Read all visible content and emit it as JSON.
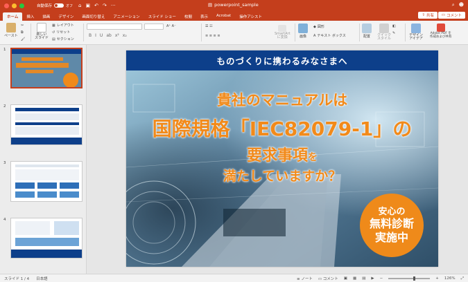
{
  "titlebar": {
    "autosave_label": "自動保存",
    "autosave_state": "オフ",
    "doc_title": "powerpoint_sample",
    "accent": "#c43e1c"
  },
  "tabs": [
    "ホーム",
    "挿入",
    "描画",
    "デザイン",
    "画面切り替え",
    "アニメーション",
    "スライド ショー",
    "校閲",
    "表示",
    "Acrobat",
    "操作アシスト"
  ],
  "active_tab": "ホーム",
  "share_label": "共有",
  "comment_label": "コメント",
  "ribbon": {
    "paste": "ペースト",
    "new_slide": "新しい\nスライド",
    "layout": "レイアウト",
    "reset": "リセット",
    "section": "セクション",
    "smartart": "SmartArt\nに変換",
    "image": "画像",
    "shape": "図形",
    "textbox": "テキスト ボックス",
    "arrange": "配置",
    "quick_style": "クイック\nスタイル",
    "design_ideas": "デザイン\nアイデア",
    "adobe": "Adobe PDF を\n作成および共有",
    "format_buttons": [
      "B",
      "I",
      "U",
      "ab",
      "x²",
      "x₂"
    ]
  },
  "thumbnails": [
    {
      "num": "1"
    },
    {
      "num": "2"
    },
    {
      "num": "3"
    },
    {
      "num": "4"
    }
  ],
  "slide": {
    "banner": "ものづくりに携わるみなさまへ",
    "line1": "貴社のマニュアルは",
    "line2": "国際規格「IEC82079-1」の",
    "line3_main": "要求事項",
    "line3_small": "を",
    "line4": "満たしていますか？",
    "badge_line1": "安心の",
    "badge_line2": "無料診断",
    "badge_line3": "実施中",
    "banner_color": "#0d3f8a",
    "title_color": "#f28a1a"
  },
  "status": {
    "slide_info": "スライド 1 / 4",
    "language": "日本語",
    "notes": "ノート",
    "comments": "コメント",
    "zoom": "126%"
  }
}
